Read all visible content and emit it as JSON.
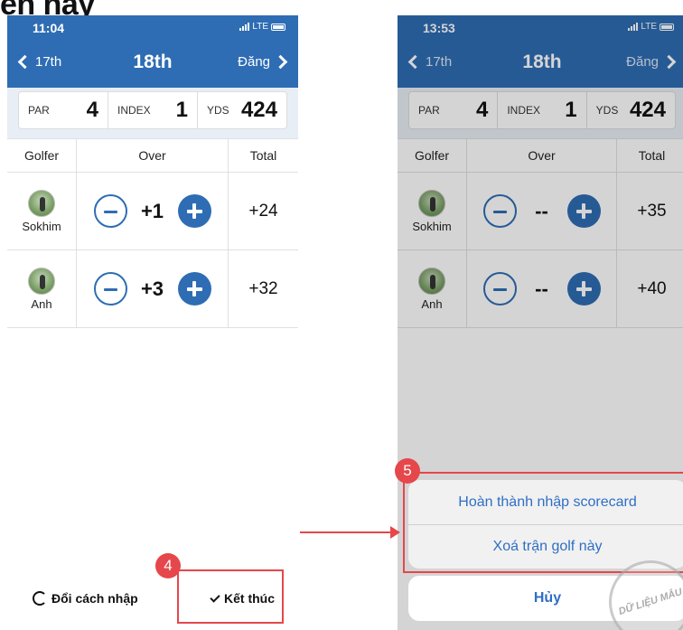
{
  "header_fragment": "ên hay",
  "left_phone": {
    "status_time": "11:04",
    "status_network": "LTE",
    "nav": {
      "prev": "17th",
      "title": "18th",
      "next": "Đăng"
    },
    "hole_info": {
      "par_label": "PAR",
      "par": "4",
      "index_label": "INDEX",
      "index": "1",
      "yds_label": "YDS",
      "yds": "424"
    },
    "table_headers": {
      "golfer": "Golfer",
      "over": "Over",
      "total": "Total"
    },
    "rows": [
      {
        "name": "Sokhim",
        "over": "+1",
        "total": "+24"
      },
      {
        "name": "Anh",
        "over": "+3",
        "total": "+32"
      }
    ],
    "bottom": {
      "switch_input": "Đổi cách nhập",
      "finish": "Kết thúc"
    }
  },
  "right_phone": {
    "status_time": "13:53",
    "status_network": "LTE",
    "nav": {
      "prev": "17th",
      "title": "18th",
      "next": "Đăng"
    },
    "hole_info": {
      "par_label": "PAR",
      "par": "4",
      "index_label": "INDEX",
      "index": "1",
      "yds_label": "YDS",
      "yds": "424"
    },
    "table_headers": {
      "golfer": "Golfer",
      "over": "Over",
      "total": "Total"
    },
    "rows": [
      {
        "name": "Sokhim",
        "over": "--",
        "total": "+35"
      },
      {
        "name": "Anh",
        "over": "--",
        "total": "+40"
      }
    ],
    "action_sheet": {
      "complete": "Hoàn thành nhập scorecard",
      "delete": "Xoá trận golf này",
      "cancel": "Hủy"
    }
  },
  "annotations": {
    "step4": "4",
    "step5": "5",
    "accent_color": "#e5474b"
  },
  "watermark": "DỮ LIỆU MẪU",
  "colors": {
    "nav_blue": "#2e6db4",
    "action_blue": "#2f6fc4"
  }
}
